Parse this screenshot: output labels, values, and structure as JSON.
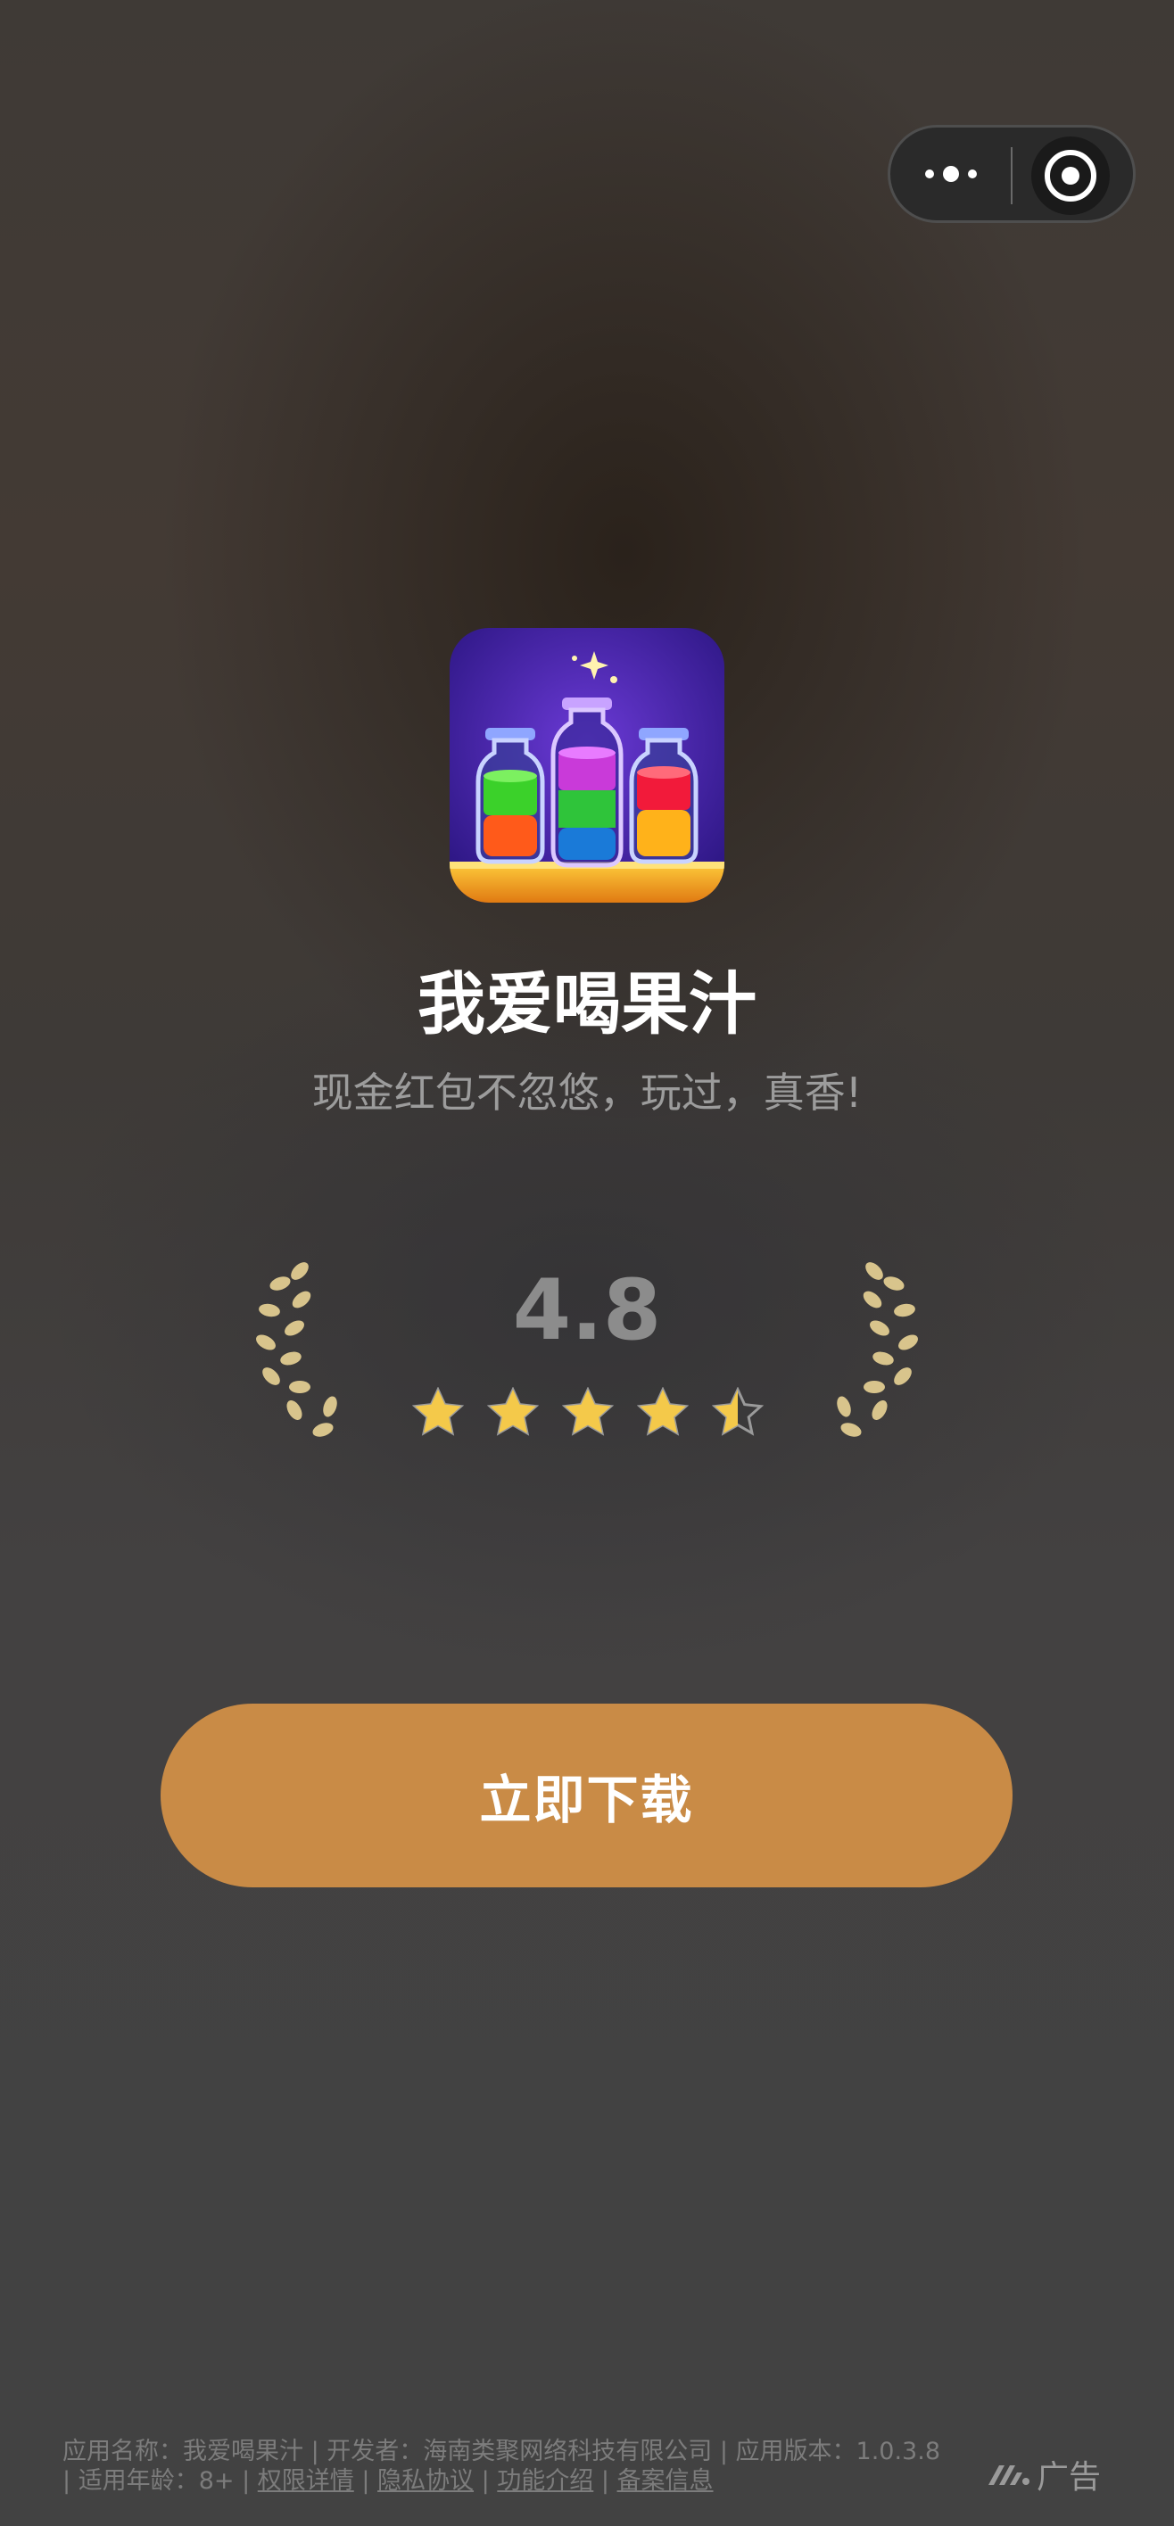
{
  "capsule": {
    "menu_icon": "more-dots-icon",
    "close_icon": "close-target-icon"
  },
  "app": {
    "icon": "juice-bottles-app-icon",
    "name": "我爱喝果汁",
    "slogan": "现金红包不忽悠，玩过，真香!"
  },
  "rating": {
    "score": "4.8",
    "value": 4.8,
    "max": 5,
    "star_color": "#f4c94a",
    "laurel_color": "#d8c48c"
  },
  "download": {
    "label": "立即下载",
    "color": "#c98b46"
  },
  "footer": {
    "app_name_label": "应用名称：",
    "app_name": "我爱喝果汁",
    "sep": " | ",
    "developer_label": "开发者：",
    "developer": "海南类聚网络科技有限公司",
    "version_label": "应用版本：",
    "version": "1.0.3.8",
    "age_label": "适用年龄：",
    "age": "8+",
    "permissions": "权限详情",
    "privacy": "隐私协议",
    "features": "功能介绍",
    "filing": "备案信息"
  },
  "ad": {
    "label": "广告",
    "icon": "ad-logo-icon"
  }
}
